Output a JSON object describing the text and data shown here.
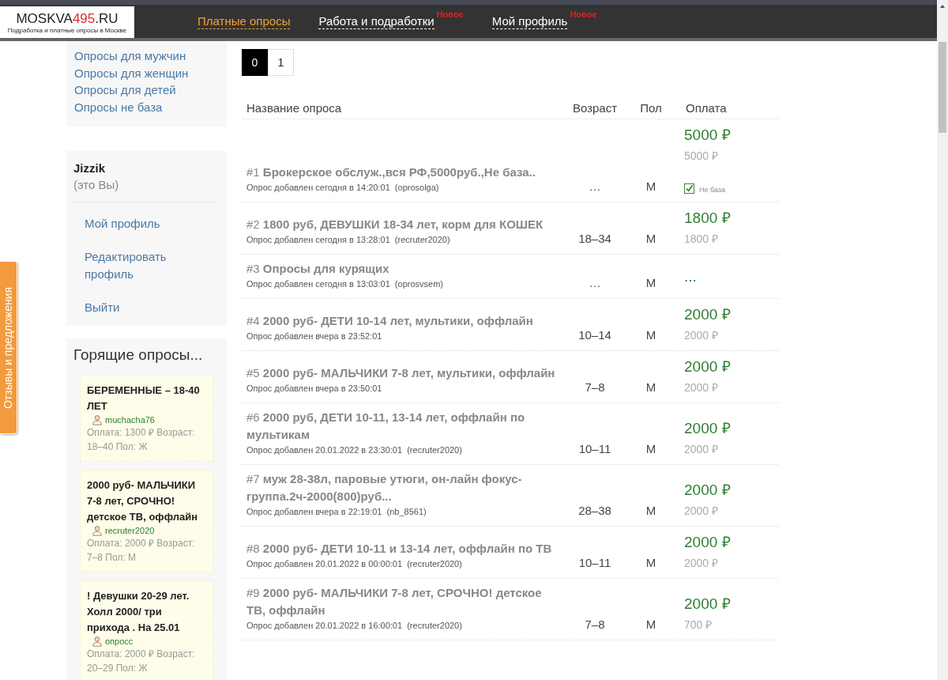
{
  "header": {
    "logo": {
      "prefix": "MOSKVA",
      "accent": "495",
      "suffix": ".RU",
      "tagline": "Подработка и платные опросы в Москве"
    },
    "nav": [
      {
        "label": "Платные опросы",
        "selected": true
      },
      {
        "label": "Работа и подработки",
        "selected": false,
        "badge": "Новое"
      },
      {
        "label": "Мой профиль",
        "selected": false,
        "badge": "Новое"
      }
    ]
  },
  "feedback_tab": {
    "label": "Отзывы и предложения"
  },
  "sidebar": {
    "category_links": [
      "Опросы для мужчин",
      "Опросы для женщин",
      "Опросы для детей",
      "Опросы не база"
    ],
    "user": {
      "name": "Jizzik",
      "note": "(это Вы)",
      "links": [
        "Мой профиль",
        "Редактировать профиль",
        "Выйти"
      ]
    },
    "hot": {
      "title": "Горящие опросы...",
      "cards": [
        {
          "title": "БЕРЕМЕННЫЕ – 18-40 ЛЕТ",
          "author": "muchacha76",
          "details": "Оплата: 1300 ₽ Возраст: 18–40 Пол: Ж"
        },
        {
          "title": "2000 руб- МАЛЬЧИКИ 7-8 лет, СРОЧНО! детское ТВ, оффлайн",
          "author": "recruter2020",
          "details": "Оплата: 2000 ₽ Возраст: 7–8 Пол: М"
        },
        {
          "title": "! Девушки 20-29 лет. Холл 2000/ три прихода . На 25.01",
          "author": "опросс",
          "details": "Оплата: 2000 ₽ Возраст: 20–29 Пол: Ж"
        }
      ]
    }
  },
  "pagination": [
    {
      "label": "0",
      "selected": true
    },
    {
      "label": "1",
      "selected": false
    }
  ],
  "table": {
    "columns": [
      "Название опроса",
      "Возраст",
      "Пол",
      "Оплата"
    ],
    "rows": [
      {
        "title": "#1 **Брокерское обслуж.,вся РФ,5000руб.,Не база..**",
        "meta": "Опрос добавлен сегодня в 14:20:01  (oprosolga)",
        "age": "…",
        "gender": "М",
        "price": "5000 ₽",
        "price_sub": "5000 ₽",
        "not_base": {
          "checked": true,
          "label": "Не база"
        }
      },
      {
        "title": "#2 **1800 руб, ДЕВУШКИ 18-34 лет, корм для КОШЕК**",
        "meta": "Опрос добавлен сегодня в 13:28:01  (recruter2020)",
        "age": "18–34",
        "gender": "М",
        "price": "1800 ₽",
        "price_sub": "1800 ₽"
      },
      {
        "title": "#3 **Опросы для курящих**",
        "meta": "Опрос добавлен сегодня в 13:03:01  (oprosvsem)",
        "age": "…",
        "gender": "М",
        "price": "..."
      },
      {
        "title": "#4 **2000 руб- ДЕТИ 10-14 лет, мультики, оффлайн**",
        "meta": "Опрос добавлен вчера в 23:52:01",
        "age": "10–14",
        "gender": "М",
        "price": "2000 ₽",
        "price_sub": "2000 ₽"
      },
      {
        "title": "#5 **2000 руб- МАЛЬЧИКИ 7-8 лет, мультики, оффлайн**",
        "meta": "Опрос добавлен вчера в 23:50:01",
        "age": "7–8",
        "gender": "М",
        "price": "2000 ₽",
        "price_sub": "2000 ₽"
      },
      {
        "title": "#6 **2000 руб, ДЕТИ 10-11, 13-14 лет, оффлайн по мультикам**",
        "meta": "Опрос добавлен 20.01.2022 в 23:30:01  (recruter2020)",
        "age": "10–11",
        "gender": "М",
        "price": "2000 ₽",
        "price_sub": "2000 ₽"
      },
      {
        "title": "#7 **муж 28-38л, паровые утюги, он-лайн фокус-группа.2ч-2000(800)руб...**",
        "meta": "Опрос добавлен вчера в 22:19:01  (nb_8561)",
        "age": "28–38",
        "gender": "М",
        "price": "2000 ₽",
        "price_sub": "2000 ₽"
      },
      {
        "title": "#8 **2000 руб- ДЕТИ 10-11 и 13-14 лет, оффлайн по ТВ**",
        "meta": "Опрос добавлен 20.01.2022 в 00:00:01  (recruter2020)",
        "age": "10–11",
        "gender": "М",
        "price": "2000 ₽",
        "price_sub": "2000 ₽"
      },
      {
        "title": "#9 **2000 руб- МАЛЬЧИКИ 7-8 лет, СРОЧНО! детское ТВ, оффлайн**",
        "meta": "Опрос добавлен 20.01.2022 в 16:00:01  (recruter2020)",
        "age": "7–8",
        "gender": "М",
        "price": "2000 ₽",
        "price_sub": "700 ₽"
      }
    ]
  }
}
